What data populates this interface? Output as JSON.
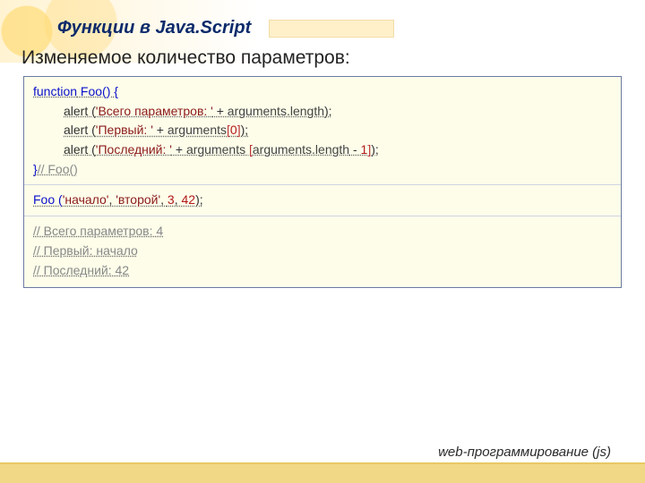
{
  "title": "Функции в Java.Script",
  "subtitle": "Изменяемое количество параметров:",
  "code": {
    "fn_open_a": "function",
    "fn_open_b": " Foo() {",
    "l1_a": "alert (",
    "l1_b": "'Всего параметров: '",
    "l1_c": " + ",
    "l1_d": "arguments.",
    "l1_e": "length",
    "l1_f": ");",
    "l2_a": "alert (",
    "l2_b": "'Первый: '",
    "l2_c": " + ",
    "l2_d": "arguments",
    "l2_e": "[",
    "l2_f": "0",
    "l2_g": "]",
    "l2_h": ");",
    "l3_a": "alert (",
    "l3_b": "'Последний: '",
    "l3_c": " + ",
    "l3_d": "arguments ",
    "l3_e": "[",
    "l3_f": "arguments.",
    "l3_g": "length",
    "l3_h": " - ",
    "l3_i": "1",
    "l3_j": "]",
    "l3_k": ");",
    "fn_close_a": "}",
    "fn_close_b": "// Foo()",
    "call_a": "Foo (",
    "call_b": "'начало'",
    "call_c": ", ",
    "call_d": "'второй'",
    "call_e": ", ",
    "call_f": "3",
    "call_g": ", ",
    "call_h": "42",
    "call_i": ");",
    "out1": "// Всего параметров: 4",
    "out2": "// Первый: начало",
    "out3": "// Последний: 42"
  },
  "footer": "web-программирование (js)"
}
